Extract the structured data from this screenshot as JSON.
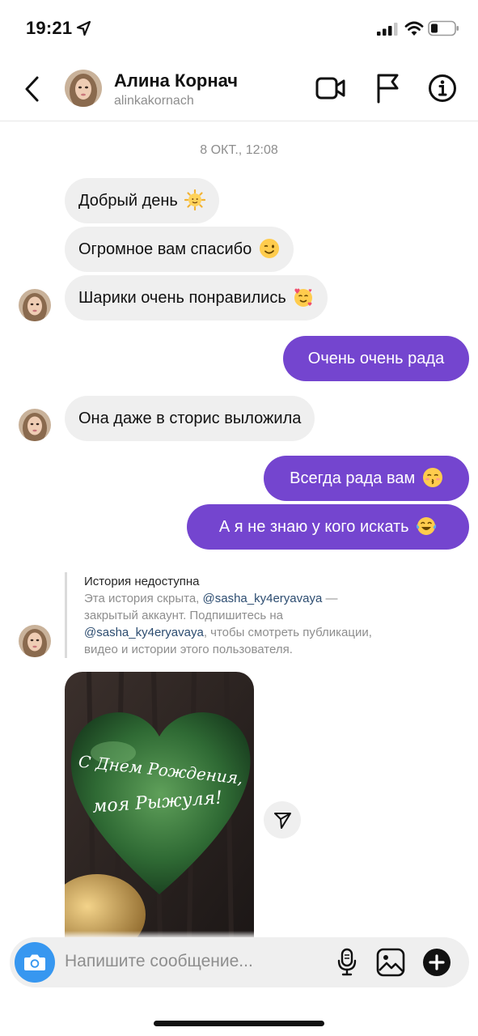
{
  "status_bar": {
    "time": "19:21"
  },
  "header": {
    "name": "Алина Корнач",
    "username": "alinkakornach"
  },
  "chat": {
    "timestamp": "8 ОКТ., 12:08",
    "messages": [
      {
        "from": "them",
        "text": "Добрый день",
        "emoji": "sun-face-emoji"
      },
      {
        "from": "them",
        "text": "Огромное вам спасибо",
        "emoji": "winking-face-emoji"
      },
      {
        "from": "them",
        "text": "Шарики очень понравились",
        "emoji": "smiling-face-with-hearts-emoji"
      },
      {
        "from": "me",
        "text": "Очень очень рада"
      },
      {
        "from": "them",
        "text": "Она даже в сторис выложила"
      },
      {
        "from": "me",
        "text": "Всегда рада вам",
        "emoji": "kissing-face-emoji"
      },
      {
        "from": "me",
        "text": "А я не знаю у кого искать",
        "emoji": "tears-of-joy-emoji"
      }
    ],
    "story": {
      "title": "История недоступна",
      "line1_prefix": "Эта история скрыта, ",
      "mention1": "@sasha_ky4eryavaya",
      "line1_suffix": " —",
      "line2": "закрытый аккаунт. Подпишитесь на",
      "mention2": "@sasha_ky4eryavaya",
      "line3_suffix": ", чтобы смотреть публикации,",
      "line4": "видео и истории этого пользователя."
    },
    "photo": {
      "balloon_text_line1": "С Днем Рождения,",
      "balloon_text_line2": "моя Рыжуля!"
    }
  },
  "composer": {
    "placeholder": "Напишите сообщение..."
  },
  "colors": {
    "outgoing_bubble": "#7445cf",
    "incoming_bubble": "#efefef",
    "camera_button": "#3797f0"
  }
}
